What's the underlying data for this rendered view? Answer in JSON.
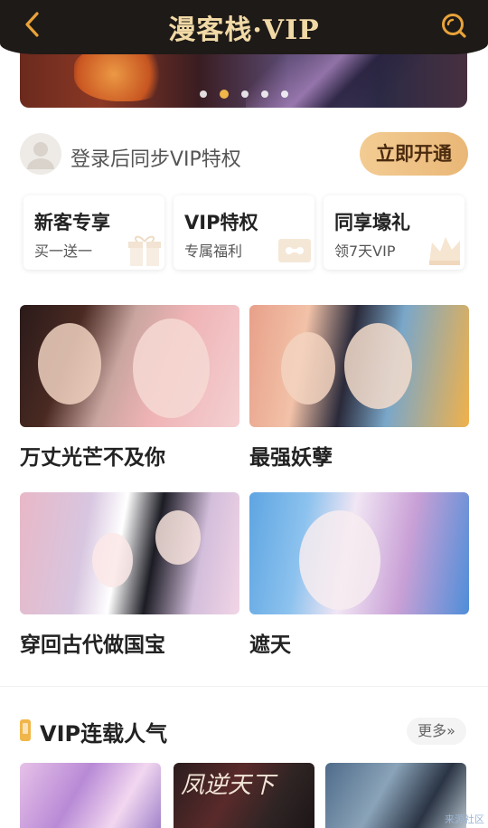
{
  "header": {
    "brand": "漫客栈·VIP",
    "back_icon": "chevron-left-icon",
    "search_icon": "search-icon",
    "accent": "#e8a33a"
  },
  "banner": {
    "dots": 5,
    "active_index": 1
  },
  "login": {
    "text": "登录后同步VIP特权",
    "button": "立即开通"
  },
  "privileges": [
    {
      "title": "新客专享",
      "subtitle": "买一送一",
      "icon": "gift-icon"
    },
    {
      "title": "VIP特权",
      "subtitle": "专属福利",
      "icon": "ticket-icon"
    },
    {
      "title": "同享壕礼",
      "subtitle": "领7天VIP",
      "icon": "crown-icon"
    }
  ],
  "comics": [
    {
      "title": "万丈光芒不及你"
    },
    {
      "title": "最强妖孽"
    },
    {
      "title": "穿回古代做国宝"
    },
    {
      "title": "遮天"
    }
  ],
  "section": {
    "title": "VIP连载人气",
    "more": "更多»"
  },
  "thumbs": [
    {
      "caption": ""
    },
    {
      "caption": "凤逆天下"
    },
    {
      "caption": ""
    }
  ],
  "watermark": "来源社区"
}
